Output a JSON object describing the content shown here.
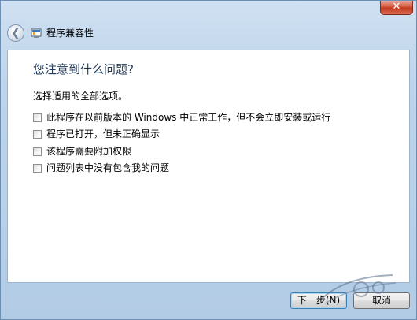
{
  "window": {
    "title": "程序兼容性",
    "close_label": "✕"
  },
  "header": {
    "back_label": "❮"
  },
  "main": {
    "question": "您注意到什么问题?",
    "instruction": "选择适用的全部选项。",
    "options": [
      {
        "label": "此程序在以前版本的 Windows 中正常工作，但不会立即安装或运行",
        "checked": false
      },
      {
        "label": "程序已打开，但未正确显示",
        "checked": false
      },
      {
        "label": "该程序需要附加权限",
        "checked": false
      },
      {
        "label": "问题列表中没有包含我的问题",
        "checked": false
      }
    ]
  },
  "footer": {
    "next_label": "下一步(N)",
    "cancel_label": "取消"
  }
}
